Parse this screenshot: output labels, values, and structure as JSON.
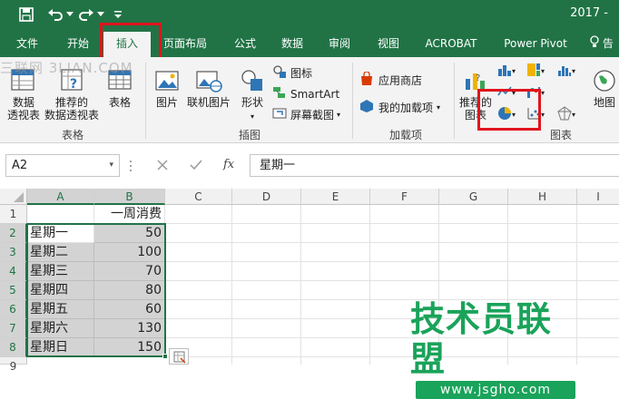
{
  "window": {
    "title": "2017 -"
  },
  "tabs": [
    {
      "label": "文件",
      "active": false
    },
    {
      "label": "开始",
      "active": false
    },
    {
      "label": "插入",
      "active": true
    },
    {
      "label": "页面布局",
      "active": false
    },
    {
      "label": "公式",
      "active": false
    },
    {
      "label": "数据",
      "active": false
    },
    {
      "label": "审阅",
      "active": false
    },
    {
      "label": "视图",
      "active": false
    },
    {
      "label": "ACROBAT",
      "active": false
    },
    {
      "label": "Power Pivot",
      "active": false
    },
    {
      "label": "告",
      "active": false
    }
  ],
  "watermark": "三联网 3LIAN.COM",
  "ribbon": {
    "tables": {
      "group_label": "表格",
      "pivot_label_1": "数据",
      "pivot_label_2": "透视表",
      "rec_pivot_label_1": "推荐的",
      "rec_pivot_label_2": "数据透视表",
      "table_label": "表格"
    },
    "illustrations": {
      "group_label": "插图",
      "picture_label": "图片",
      "online_picture_label": "联机图片",
      "shapes_label": "形状",
      "icons_label": "图标",
      "smartart_label": "SmartArt",
      "screenshot_label": "屏幕截图"
    },
    "addins": {
      "group_label": "加载项",
      "store_label": "应用商店",
      "my_addins_label": "我的加载项"
    },
    "charts": {
      "group_label": "图表",
      "recommended_label_1": "推荐的",
      "recommended_label_2": "图表",
      "map_label": "地图"
    }
  },
  "formula_bar": {
    "name_box": "A2",
    "fx_label": "fx",
    "formula": "星期一"
  },
  "sheet": {
    "columns": [
      "A",
      "B",
      "C",
      "D",
      "E",
      "F",
      "G",
      "H",
      "I"
    ],
    "rows": [
      "1",
      "2",
      "3",
      "4",
      "5",
      "6",
      "7",
      "8",
      "9"
    ],
    "header_b1": "一周消费",
    "data": [
      {
        "day": "星期一",
        "value": "50"
      },
      {
        "day": "星期二",
        "value": "100"
      },
      {
        "day": "星期三",
        "value": "70"
      },
      {
        "day": "星期四",
        "value": "80"
      },
      {
        "day": "星期五",
        "value": "60"
      },
      {
        "day": "星期六",
        "value": "130"
      },
      {
        "day": "星期日",
        "value": "150"
      }
    ]
  },
  "site_watermark": {
    "title": "技术员联盟",
    "url": "www.jsgho.com"
  },
  "colors": {
    "excel_green": "#217346",
    "highlight_red": "#e0141e",
    "watermark_green": "#1aa35a"
  }
}
